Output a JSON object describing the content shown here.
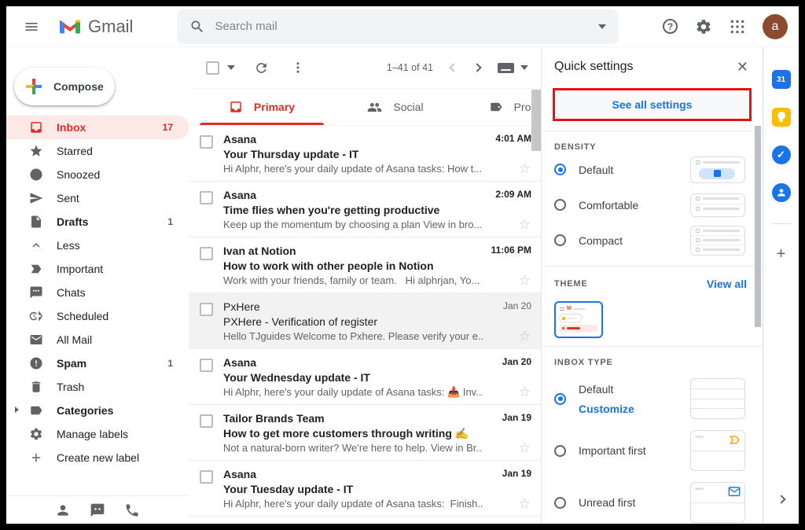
{
  "colors": {
    "accent_red": "#d93025",
    "link_blue": "#1a73e8",
    "annotation_red": "#e81010",
    "avatar_bg": "#8c4a2f",
    "search_bg": "#f1f3f4"
  },
  "topbar": {
    "logo_text": "Gmail",
    "search_placeholder": "Search mail",
    "avatar_letter": "a"
  },
  "sidebar": {
    "compose_label": "Compose",
    "items": [
      {
        "label": "Inbox",
        "count": "17",
        "icon": "inbox-icon",
        "active": true
      },
      {
        "label": "Starred",
        "count": "",
        "icon": "star-icon"
      },
      {
        "label": "Snoozed",
        "count": "",
        "icon": "clock-icon"
      },
      {
        "label": "Sent",
        "count": "",
        "icon": "send-icon"
      },
      {
        "label": "Drafts",
        "count": "1",
        "icon": "draft-icon",
        "bold": true
      },
      {
        "label": "Less",
        "count": "",
        "icon": "chevron-up-icon"
      },
      {
        "label": "Important",
        "count": "",
        "icon": "label-important-icon"
      },
      {
        "label": "Chats",
        "count": "",
        "icon": "chat-icon"
      },
      {
        "label": "Scheduled",
        "count": "",
        "icon": "schedule-send-icon"
      },
      {
        "label": "All Mail",
        "count": "",
        "icon": "envelope-icon"
      },
      {
        "label": "Spam",
        "count": "1",
        "icon": "spam-icon",
        "bold": true
      },
      {
        "label": "Trash",
        "count": "",
        "icon": "trash-icon"
      },
      {
        "label": "Categories",
        "count": "",
        "icon": "tag-icon",
        "bold": true,
        "expandable": true
      },
      {
        "label": "Manage labels",
        "count": "",
        "icon": "gear-icon"
      },
      {
        "label": "Create new label",
        "count": "",
        "icon": "plus-icon"
      }
    ],
    "footer_icons": [
      "person-icon",
      "hangouts-icon",
      "phone-icon"
    ]
  },
  "mail": {
    "pagination": "1–41 of 41",
    "tabs": [
      {
        "label": "Primary",
        "icon": "inbox-tab-icon",
        "active": true
      },
      {
        "label": "Social",
        "icon": "people-icon",
        "active": false
      },
      {
        "label": "Promotions",
        "icon": "tag-icon",
        "active": false
      }
    ],
    "emails": [
      {
        "sender": "Asana",
        "subject": "Your Thursday update - IT",
        "snippet": "Hi Alphr, here's your daily update of Asana tasks: How t...",
        "time": "4:01 AM",
        "unread": true
      },
      {
        "sender": "Asana",
        "subject": "Time flies when you're getting productive",
        "snippet": "Keep up the momentum by choosing a plan View in bro...",
        "time": "2:09 AM",
        "unread": true
      },
      {
        "sender": "Ivan at Notion",
        "subject": "How to work with other people in Notion",
        "snippet": "Work with your friends, family or team.   Hi alphrjan, Yo...",
        "time": "11:06 PM",
        "unread": true
      },
      {
        "sender": "PxHere",
        "subject": "PXHere - Verification of register",
        "snippet": "Hello TJguides Welcome to Pxhere. Please verify your e...",
        "time": "Jan 20",
        "unread": false
      },
      {
        "sender": "Asana",
        "subject": "Your Wednesday update - IT",
        "snippet": "Hi Alphr, here's your daily update of Asana tasks: 📥 Inv...",
        "time": "Jan 20",
        "unread": true
      },
      {
        "sender": "Tailor Brands Team",
        "subject": "How to get more customers through writing ✍️",
        "snippet": "Not a natural-born writer? We're here to help. View in Br...",
        "time": "Jan 19",
        "unread": true
      },
      {
        "sender": "Asana",
        "subject": "Your Tuesday update - IT",
        "snippet": "Hi Alphr, here's your daily update of Asana tasks:  Finish...",
        "time": "Jan 19",
        "unread": true
      }
    ]
  },
  "quick_settings": {
    "title": "Quick settings",
    "see_all_label": "See all settings",
    "density": {
      "heading": "DENSITY",
      "options": [
        {
          "label": "Default",
          "selected": true
        },
        {
          "label": "Comfortable",
          "selected": false
        },
        {
          "label": "Compact",
          "selected": false
        }
      ]
    },
    "theme": {
      "heading": "THEME",
      "view_all_label": "View all"
    },
    "inbox_type": {
      "heading": "INBOX TYPE",
      "options": [
        {
          "label": "Default",
          "link": "Customize",
          "selected": true
        },
        {
          "label": "Important first",
          "selected": false
        },
        {
          "label": "Unread first",
          "selected": false
        }
      ]
    }
  },
  "right_rail": {
    "calendar_day": "31",
    "icons": [
      "calendar-icon",
      "keep-icon",
      "tasks-icon",
      "contacts-icon",
      "plus-icon",
      "chevron-right-icon"
    ]
  }
}
